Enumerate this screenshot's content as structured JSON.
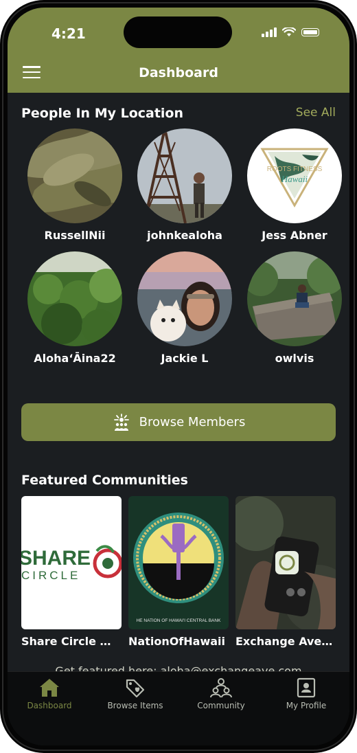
{
  "status_bar": {
    "time": "4:21"
  },
  "header": {
    "title": "Dashboard"
  },
  "people_section": {
    "title": "People In My Location",
    "see_all": "See All",
    "people": [
      {
        "name": "RussellNii"
      },
      {
        "name": "johnkealoha"
      },
      {
        "name": "Jess Abner"
      },
      {
        "name": "Aloha‘Āina22"
      },
      {
        "name": "Jackie L"
      },
      {
        "name": "owlvis"
      }
    ],
    "logo_text": [
      "ROOTS FITNESS",
      "Hawaii"
    ]
  },
  "browse_members": {
    "label": "Browse Members",
    "icon": "people-network-icon"
  },
  "communities_section": {
    "title": "Featured Communities",
    "items": [
      {
        "name": "Share Circle M...",
        "logo_text": [
          "SHARE",
          "CIRCLE"
        ]
      },
      {
        "name": "NationOfHawaii",
        "logo_text": "HE NATION OF HAWAI'I CENTRAL BANK"
      },
      {
        "name": "Exchange Ave ..."
      }
    ]
  },
  "footer_note": "Get featured here: aloha@exchangeave.com",
  "bottom_nav": [
    {
      "label": "Dashboard",
      "icon": "home-icon",
      "active": true
    },
    {
      "label": "Browse Items",
      "icon": "tag-heart-icon",
      "active": false
    },
    {
      "label": "Community",
      "icon": "community-icon",
      "active": false
    },
    {
      "label": "My Profile",
      "icon": "profile-card-icon",
      "active": false
    }
  ],
  "colors": {
    "accent": "#7b8744",
    "link": "#a2ab5c",
    "background": "#1b1e21"
  }
}
